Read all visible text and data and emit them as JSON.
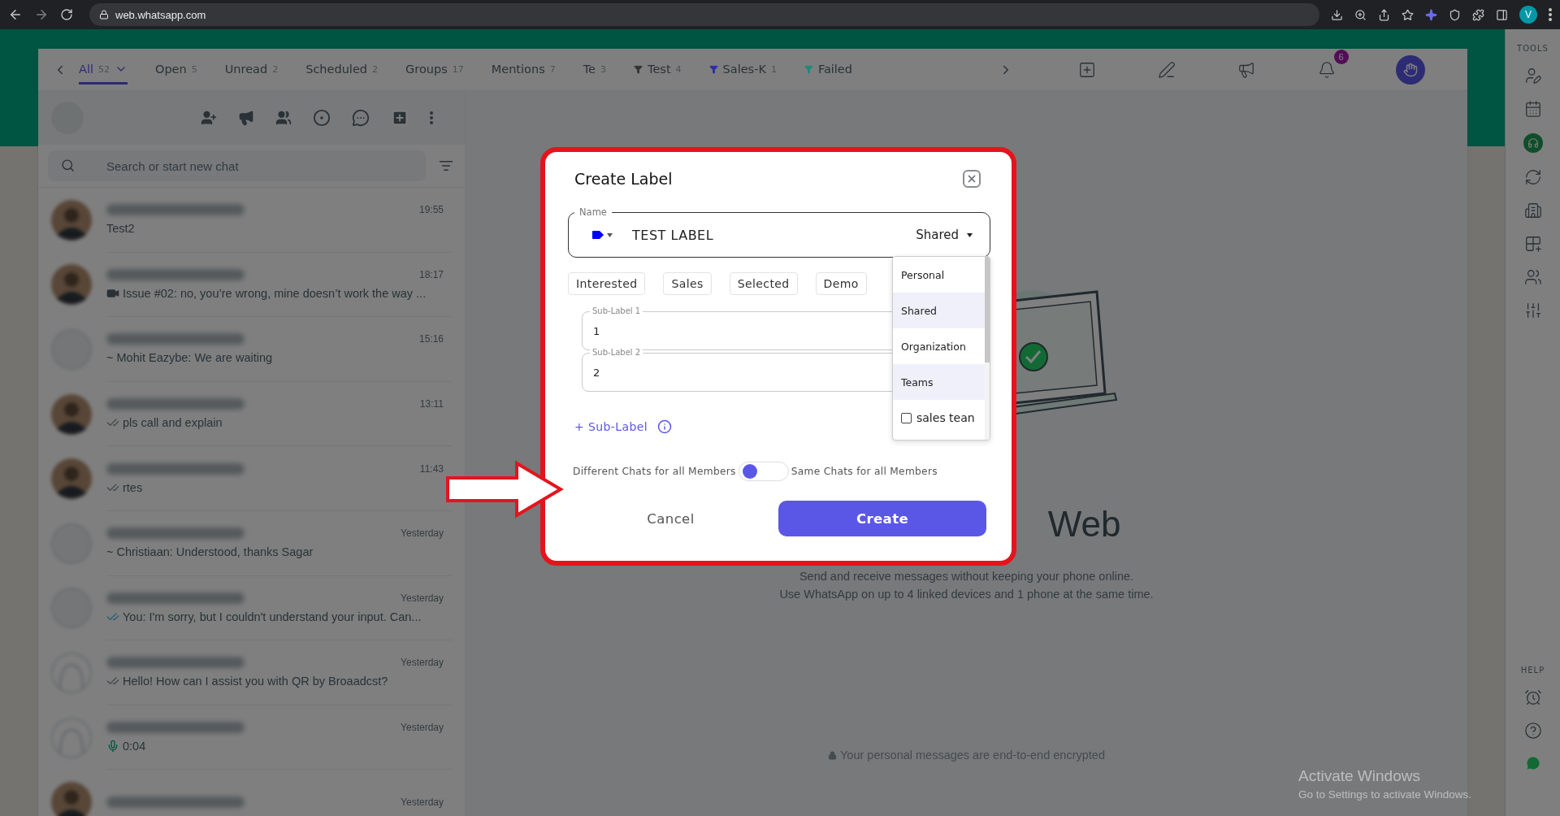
{
  "browser": {
    "url": "web.whatsapp.com",
    "profile_initial": "V"
  },
  "tabs": [
    {
      "label": "All",
      "count": "52",
      "selected": true,
      "kind": "menu"
    },
    {
      "label": "Open",
      "count": "5",
      "selected": false,
      "kind": "plain"
    },
    {
      "label": "Unread",
      "count": "2",
      "selected": false,
      "kind": "plain"
    },
    {
      "label": "Scheduled",
      "count": "2",
      "selected": false,
      "kind": "plain"
    },
    {
      "label": "Groups",
      "count": "17",
      "selected": false,
      "kind": "plain"
    },
    {
      "label": "Mentions",
      "count": "7",
      "selected": false,
      "kind": "plain"
    },
    {
      "label": "Te",
      "count": "3",
      "selected": false,
      "kind": "plain"
    },
    {
      "label": "Test",
      "count": "4",
      "selected": false,
      "kind": "filter",
      "color": "#333333"
    },
    {
      "label": "Sales-K",
      "count": "1",
      "selected": false,
      "kind": "filter",
      "color": "#2b2bb0"
    },
    {
      "label": "Failed",
      "selected": false,
      "kind": "filter",
      "color": "#1c8a78"
    }
  ],
  "header": {
    "notification_count": "6"
  },
  "search": {
    "placeholder": "Search or start new chat"
  },
  "chats": [
    {
      "avatar": {
        "kind": "photo"
      },
      "time": "19:55",
      "preview": "Test2",
      "kind": "text"
    },
    {
      "avatar": {
        "kind": "photo"
      },
      "time": "18:17",
      "preview": "Issue #02: no, you’re wrong, mine doesn’t work the way ...",
      "kind": "video"
    },
    {
      "avatar": {
        "kind": "placeholder"
      },
      "time": "15:16",
      "preview": "~ Mohit Eazybe: We are waiting",
      "kind": "text"
    },
    {
      "avatar": {
        "kind": "photo"
      },
      "time": "13:11",
      "preview": "pls call and explain",
      "kind": "delivered"
    },
    {
      "avatar": {
        "kind": "photo"
      },
      "time": "11:43",
      "preview": "rtes",
      "kind": "delivered"
    },
    {
      "avatar": {
        "kind": "placeholder"
      },
      "time": "Yesterday",
      "preview": "~ Christiaan: Understood, thanks Sagar",
      "kind": "text"
    },
    {
      "avatar": {
        "kind": "placeholder"
      },
      "time": "Yesterday",
      "preview": "You: I'm sorry, but I couldn't understand your input. Can...",
      "kind": "read"
    },
    {
      "avatar": {
        "kind": "person"
      },
      "time": "Yesterday",
      "preview": "Hello! How can I assist you with QR by Broaadcst?",
      "kind": "delivered"
    },
    {
      "avatar": {
        "kind": "person"
      },
      "time": "Yesterday",
      "preview": "0:04",
      "kind": "voice"
    },
    {
      "avatar": {
        "kind": "photo"
      },
      "time": "Yesterday"
    }
  ],
  "intro": {
    "title": "Web",
    "lines": [
      "Send and receive messages without keeping your phone online.",
      "Use WhatsApp on up to 4 linked devices and 1 phone at the same time."
    ],
    "encryption": "Your personal messages are end-to-end encrypted"
  },
  "tools": {
    "title": "TOOLS"
  },
  "help": {
    "title": "HELP"
  },
  "modal": {
    "title": "Create Label",
    "name_field": {
      "label": "Name",
      "value": "TEST LABEL",
      "tag": {
        "color": "#0000ff"
      },
      "scope": "Shared"
    },
    "scope_options": [
      {
        "label": "Personal",
        "kind": "option",
        "highlighted": false
      },
      {
        "label": "Shared",
        "kind": "option",
        "highlighted": true
      },
      {
        "label": "Organization",
        "kind": "option",
        "highlighted": false
      },
      {
        "label": "Teams",
        "kind": "option",
        "highlighted": true
      },
      {
        "label": "sales tean",
        "kind": "checkbox",
        "checked": false
      }
    ],
    "chips": [
      "Interested",
      "Sales",
      "Selected",
      "Demo"
    ],
    "sub_labels": [
      {
        "label": "Sub-Label 1",
        "value": "1"
      },
      {
        "label": "Sub-Label 2",
        "value": "2"
      }
    ],
    "add_sub_label": "+ Sub-Label",
    "toggle": {
      "left_label": "Different Chats for all Members",
      "right_label": "Same Chats for all Members",
      "on": false
    },
    "cancel": "Cancel",
    "create": "Create"
  },
  "windows_notice": {
    "title": "Activate Windows",
    "subtitle": "Go to Settings to activate Windows."
  }
}
